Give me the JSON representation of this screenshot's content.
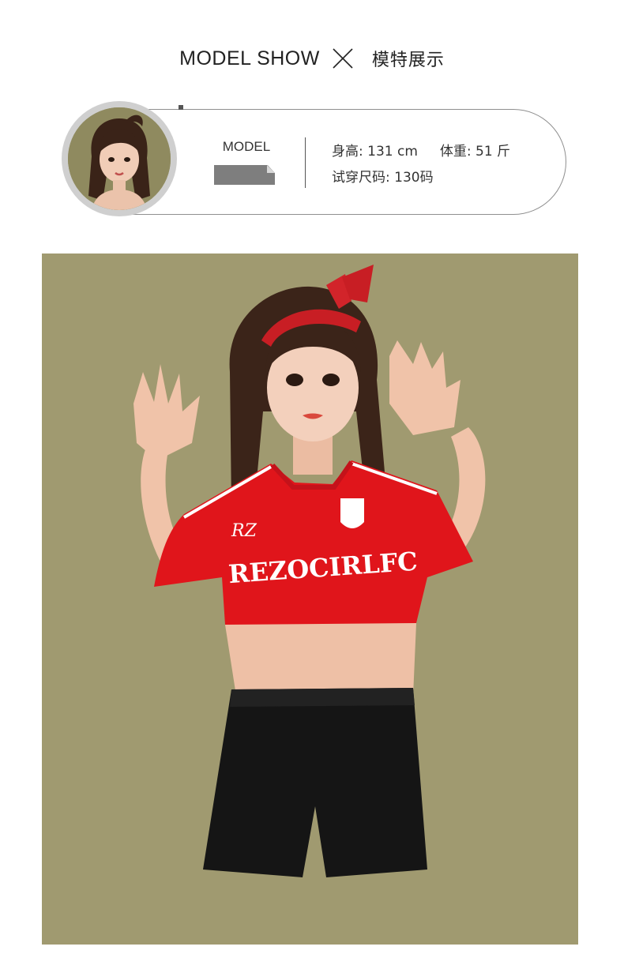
{
  "header": {
    "title_en": "MODEL SHOW",
    "separator_icon": "cross-icon",
    "title_zh": "模特展示"
  },
  "model_card": {
    "avatar_icon": "model-avatar-photo",
    "label": "MODEL",
    "height": "身高: 131 cm",
    "weight": "体重: 51 斤",
    "size": "试穿尺码: 130码"
  },
  "photo": {
    "shirt_logo": "RZ",
    "shirt_text": "REZOCIRLFC",
    "background_color": "#a09a70",
    "shirt_color": "#e0151b",
    "shorts_color": "#151515"
  }
}
